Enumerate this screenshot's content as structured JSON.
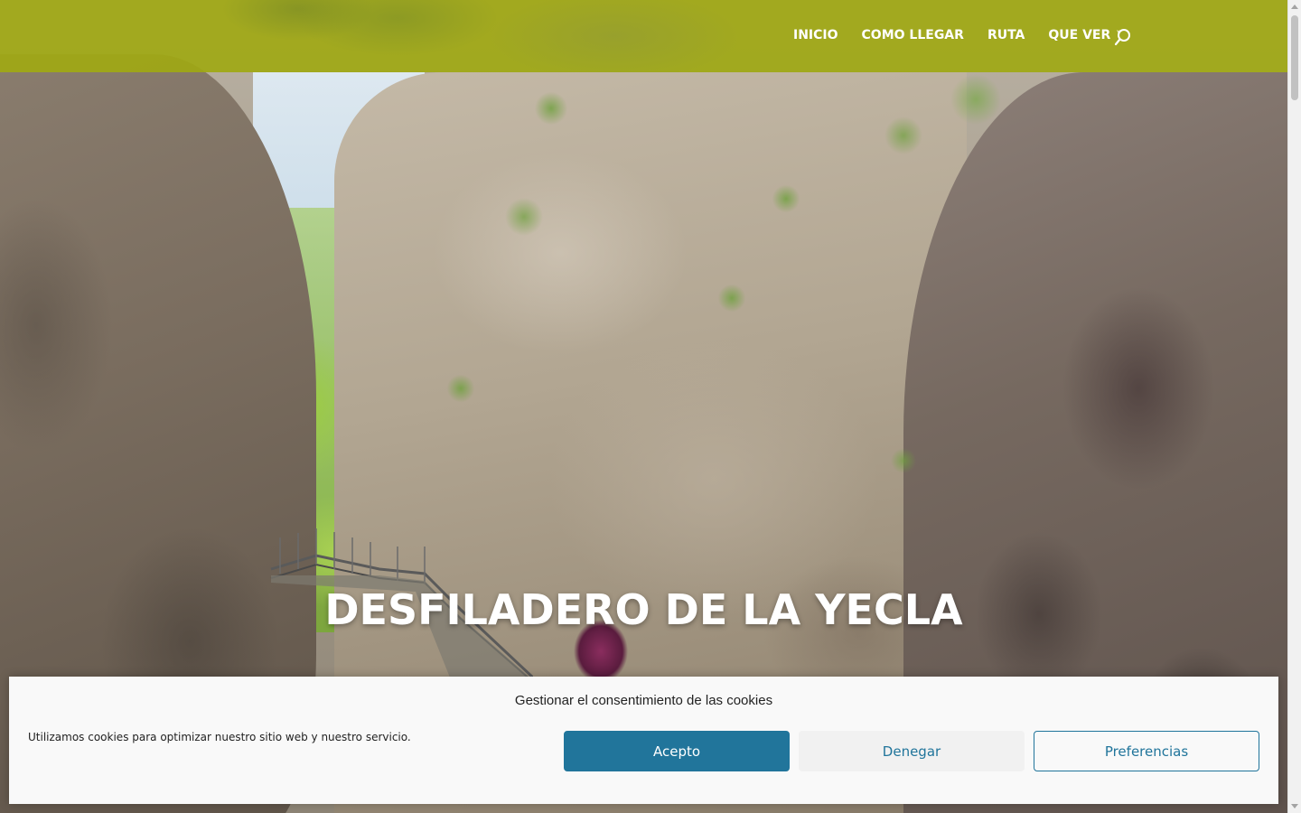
{
  "nav": {
    "items": [
      {
        "label": "INICIO"
      },
      {
        "label": "COMO LLEGAR"
      },
      {
        "label": "RUTA"
      },
      {
        "label": "QUE VER",
        "has_dropdown": true
      }
    ],
    "search_icon": "search-icon"
  },
  "hero": {
    "title": "DESFILADERO DE LA YECLA"
  },
  "cookie": {
    "title": "Gestionar el consentimiento de las cookies",
    "message": "Utilizamos cookies para optimizar nuestro sitio web y nuestro servicio.",
    "accept_label": "Acepto",
    "deny_label": "Denegar",
    "preferences_label": "Preferencias"
  },
  "colors": {
    "header_bg": "#a0a814",
    "accent": "#21759b",
    "banner_bg": "#f9f9f9"
  }
}
